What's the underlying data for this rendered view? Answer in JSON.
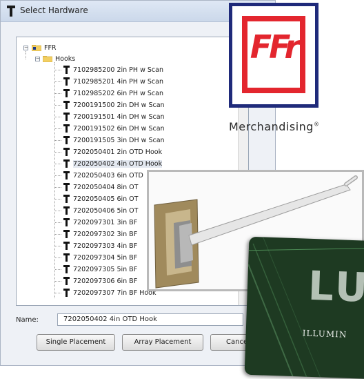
{
  "dialog": {
    "title": "Select Hardware",
    "tree": {
      "root": "FFR",
      "folder": "Hooks",
      "items": [
        "7102985200 2in PH w Scan",
        "7102985201 4in PH w Scan",
        "7102985202 6in PH w Scan",
        "7200191500 2in DH w Scan",
        "7200191501 4in DH w Scan",
        "7200191502 6in DH w Scan",
        "7200191505 3in DH w Scan",
        "7202050401 2in OTD Hook",
        "7202050402 4in OTD Hook",
        "7202050403 6in OTD",
        "7202050404 8in OT",
        "7202050405 6in OT",
        "7202050406 5in OT",
        "7202097301 3in BF",
        "7202097302 3in BF",
        "7202097303 4in BF",
        "7202097304 5in BF",
        "7202097305 5in BF",
        "7202097306 6in BF",
        "7202097307 7in BF Hook"
      ],
      "selected_index": 8
    },
    "name_label": "Name:",
    "name_value": "7202050402 4in OTD Hook",
    "buttons": {
      "single": "Single Placement",
      "array": "Array Placement",
      "cancel": "Cancel"
    }
  },
  "logo": {
    "mark": "FFr",
    "caption": "Merchandising",
    "registered": "®",
    "colors": {
      "red": "#e3262e",
      "navy": "#1f2a7a"
    }
  },
  "sign": {
    "text": "LU",
    "subtext": "ILLUMIN"
  }
}
